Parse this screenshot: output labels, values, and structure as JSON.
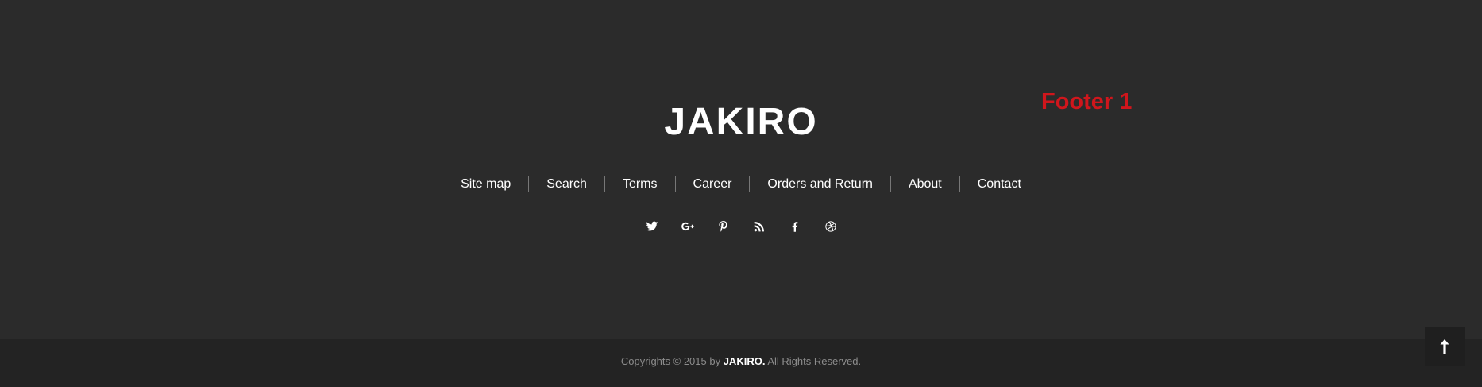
{
  "footer_label": "Footer 1",
  "brand": "JAKIRO",
  "nav": [
    {
      "label": "Site map"
    },
    {
      "label": "Search"
    },
    {
      "label": "Terms"
    },
    {
      "label": "Career"
    },
    {
      "label": "Orders and Return"
    },
    {
      "label": "About"
    },
    {
      "label": "Contact"
    }
  ],
  "social_icons": [
    "twitter-icon",
    "google-plus-icon",
    "pinterest-icon",
    "rss-icon",
    "facebook-icon",
    "dribbble-icon"
  ],
  "copyright": {
    "prefix": "Copyrights © 2015 by",
    "brand": "JAKIRO.",
    "suffix": "All Rights Reserved."
  },
  "colors": {
    "background": "#2b2b2b",
    "bottom_bar": "#232323",
    "accent_red": "#d0161c",
    "text": "#ffffff",
    "muted_text": "#8c8c8c"
  }
}
